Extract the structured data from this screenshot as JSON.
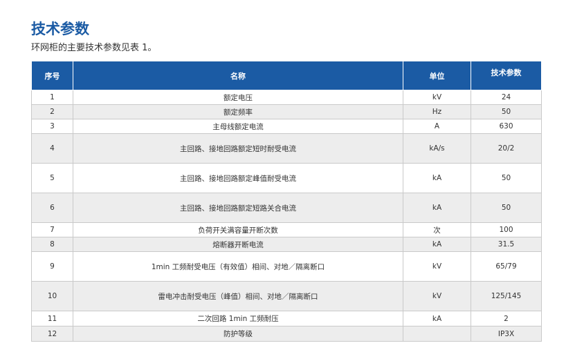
{
  "heading": "技术参数",
  "intro": "环网柜的主要技术参数见表 1。",
  "table": {
    "headers": [
      "序号",
      "名称",
      "单位",
      "技术参数"
    ],
    "rows": [
      {
        "no": "1",
        "name": "额定电压",
        "unit": "kV",
        "value": "24",
        "size": "short"
      },
      {
        "no": "2",
        "name": "额定频率",
        "unit": "Hz",
        "value": "50",
        "size": "short"
      },
      {
        "no": "3",
        "name": "主母线额定电流",
        "unit": "A",
        "value": "630",
        "size": "short"
      },
      {
        "no": "4",
        "name": "主回路、接地回路额定短时耐受电流",
        "unit": "kA/s",
        "value": "20/2",
        "size": "tall"
      },
      {
        "no": "5",
        "name": "主回路、接地回路额定峰值耐受电流",
        "unit": "kA",
        "value": "50",
        "size": "tall"
      },
      {
        "no": "6",
        "name": "主回路、接地回路额定短路关合电流",
        "unit": "kA",
        "value": "50",
        "size": "tall"
      },
      {
        "no": "7",
        "name": "负荷开关满容量开断次数",
        "unit": "次",
        "value": "100",
        "size": "short"
      },
      {
        "no": "8",
        "name": "熔断器开断电流",
        "unit": "kA",
        "value": "31.5",
        "size": "short"
      },
      {
        "no": "9",
        "name": "1min 工频耐受电压（有效值）相间、对地／隔离断口",
        "unit": "kV",
        "value": "65/79",
        "size": "tall"
      },
      {
        "no": "10",
        "name": "雷电冲击耐受电压（峰值）相间、对地／隔离断口",
        "unit": "kV",
        "value": "125/145",
        "size": "tall"
      },
      {
        "no": "11",
        "name": "二次回路 1min 工频耐压",
        "unit": "kA",
        "value": "2",
        "size": "med"
      },
      {
        "no": "12",
        "name": "防护等级",
        "unit": "",
        "value": "IP3X",
        "size": "med"
      }
    ]
  },
  "colors": {
    "accent": "#1b5ba4",
    "row_alt": "#ededed"
  }
}
